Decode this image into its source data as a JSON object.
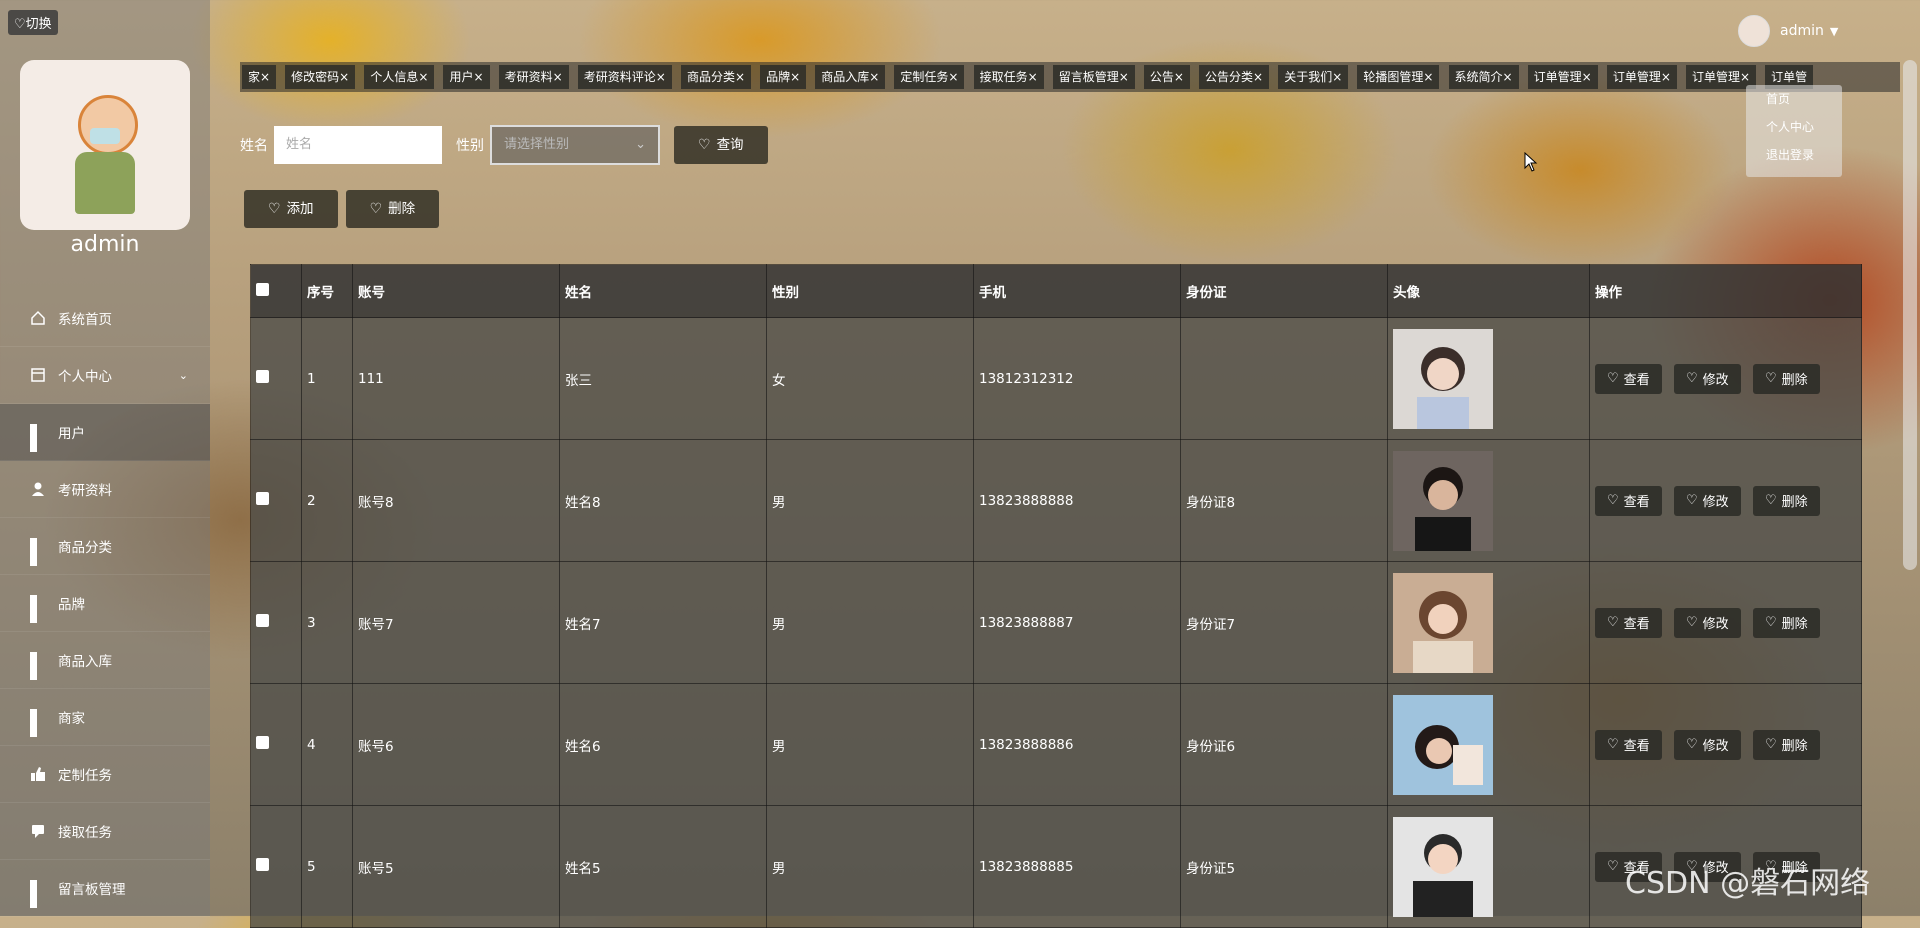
{
  "switch_label": "♡切换",
  "sidebar": {
    "admin_name": "admin",
    "items": [
      {
        "label": "系统首页",
        "icon": "home-icon"
      },
      {
        "label": "个人中心",
        "icon": "window-icon"
      },
      {
        "label": "用户",
        "icon": "grid-icon"
      },
      {
        "label": "考研资料",
        "icon": "person-icon"
      },
      {
        "label": "商品分类",
        "icon": "grid-icon"
      },
      {
        "label": "品牌",
        "icon": "grid-icon"
      },
      {
        "label": "商品入库",
        "icon": "grid-icon"
      },
      {
        "label": "商家",
        "icon": "grid-icon"
      },
      {
        "label": "定制任务",
        "icon": "thumb-icon"
      },
      {
        "label": "接取任务",
        "icon": "chat-icon"
      },
      {
        "label": "留言板管理",
        "icon": "grid-icon"
      }
    ]
  },
  "tabs": [
    "家×",
    "修改密码×",
    "个人信息×",
    "用户×",
    "考研资料×",
    "考研资料评论×",
    "商品分类×",
    "品牌×",
    "商品入库×",
    "定制任务×",
    "接取任务×",
    "留言板管理×",
    "公告×",
    "公告分类×",
    "关于我们×",
    "轮播图管理×",
    "系统简介×",
    "订单管理×",
    "订单管理×",
    "订单管理×",
    "订单管"
  ],
  "header": {
    "user_name": "admin",
    "dropdown": [
      "首页",
      "个人中心",
      "退出登录"
    ]
  },
  "search": {
    "name_label": "姓名",
    "name_placeholder": "姓名",
    "gender_label": "性别",
    "gender_placeholder": "请选择性别",
    "query_label": "查询"
  },
  "toolbar": {
    "add_label": "添加",
    "delete_label": "删除"
  },
  "table": {
    "headers": [
      "",
      "序号",
      "账号",
      "姓名",
      "性别",
      "手机",
      "身份证",
      "头像",
      "操作"
    ],
    "rows": [
      {
        "idx": "1",
        "account": "111",
        "name": "张三",
        "gender": "女",
        "phone": "13812312312",
        "id_card": ""
      },
      {
        "idx": "2",
        "account": "账号8",
        "name": "姓名8",
        "gender": "男",
        "phone": "13823888888",
        "id_card": "身份证8"
      },
      {
        "idx": "3",
        "account": "账号7",
        "name": "姓名7",
        "gender": "男",
        "phone": "13823888887",
        "id_card": "身份证7"
      },
      {
        "idx": "4",
        "account": "账号6",
        "name": "姓名6",
        "gender": "男",
        "phone": "13823888886",
        "id_card": "身份证6"
      },
      {
        "idx": "5",
        "account": "账号5",
        "name": "姓名5",
        "gender": "男",
        "phone": "13823888885",
        "id_card": "身份证5"
      }
    ],
    "row_actions": {
      "view": "查看",
      "edit": "修改",
      "delete": "删除"
    }
  },
  "watermark": "CSDN @磐石网络"
}
